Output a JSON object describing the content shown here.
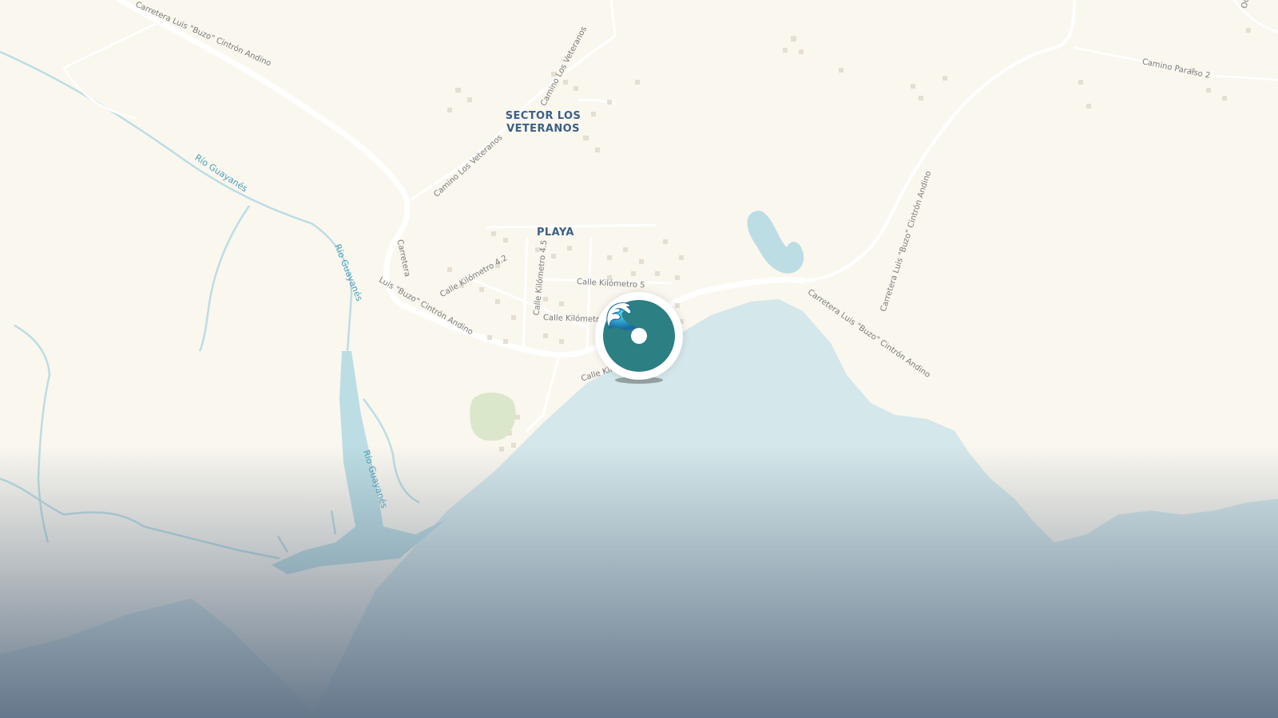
{
  "map": {
    "colors": {
      "land": "#faf7ef",
      "water": "#d4e7ea",
      "river": "#bcdde3",
      "road": "#ffffff",
      "building": "#e5ded1",
      "park": "#dbe7cb",
      "marker": "#2c7f82",
      "overlay_bottom": "#5f7185"
    },
    "places": {
      "sector": "SECTOR LOS\nVETERANOS",
      "playa": "PLAYA"
    },
    "roads": {
      "carretera_top": "Carretera Luis \"Buzo\" Cintrón Andino",
      "carretera_left_a": "Carretera",
      "carretera_left_b": "Luis \"Buzo\" Cintrón Andino",
      "carretera_right_a": "Carretera Luis \"Buzo\" Cintrón Andino",
      "carretera_right_b": "Carretera Luis \"Buzo\" Cintrón Andino",
      "camino_veteranos_1": "Camino Los Veteranos",
      "camino_veteranos_2": "Camino Los Veteranos",
      "camino_paraiso": "Camino Paraíso 2",
      "calle_km5": "Calle Kilómetro 5",
      "calle_km42": "Calle Kilómetro 4.2",
      "calle_km45": "Calle Kilómetro 4.5",
      "calle_km_short": "Calle Kilómetro",
      "calle_kil": "Calle Kil",
      "ocean_road": "Océano"
    },
    "rivers": {
      "guayanes_1": "Río Guayanés",
      "guayanes_2": "Río Guayanés",
      "guayanes_3": "Río Guayanés"
    },
    "marker": {
      "icon": "wave-icon",
      "glyph": "🌊"
    }
  }
}
